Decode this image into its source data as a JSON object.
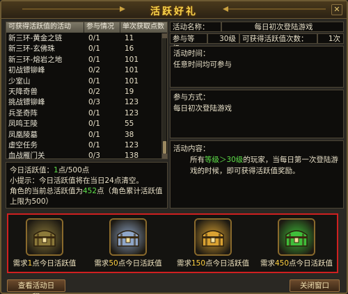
{
  "window": {
    "title": "活跃好礼",
    "close_glyph": "✕"
  },
  "activity_table": {
    "headers": [
      "可获得活跃值的活动",
      "参与情况",
      "单次获取点数"
    ],
    "rows": [
      {
        "name": "新三环-黄金之链",
        "progress": "0/1",
        "points": "11"
      },
      {
        "name": "新三环-玄佛珠",
        "progress": "0/1",
        "points": "16"
      },
      {
        "name": "新三环-熔岩之地",
        "progress": "0/1",
        "points": "101"
      },
      {
        "name": "初战镖铆峰",
        "progress": "0/2",
        "points": "101"
      },
      {
        "name": "少室山",
        "progress": "0/1",
        "points": "101"
      },
      {
        "name": "天降奇兽",
        "progress": "0/2",
        "points": "19"
      },
      {
        "name": "挑战镖铆峰",
        "progress": "0/3",
        "points": "123"
      },
      {
        "name": "兵圣奇阵",
        "progress": "0/1",
        "points": "123"
      },
      {
        "name": "凤鸣王陵",
        "progress": "0/1",
        "points": "55"
      },
      {
        "name": "凤凰陵墓",
        "progress": "0/1",
        "points": "38"
      },
      {
        "name": "虚空任务",
        "progress": "0/1",
        "points": "123"
      },
      {
        "name": "血战雁门关",
        "progress": "0/3",
        "points": "138"
      }
    ]
  },
  "today": {
    "label": "今日活跃值：",
    "current": "1",
    "suffix": "点/500点",
    "tip": "小提示：今日活跃值将在当日24点清空。",
    "total_prefix": "角色的当前总活跃值为",
    "total_value": "452",
    "total_suffix": "点（角色累计活跃值上限为500）"
  },
  "detail": {
    "name_label": "活动名称：",
    "name_value": "每日初次登陆游戏",
    "level_label": "参与等级：",
    "level_value": "30级",
    "count_label": "可获得活跃值次数：",
    "count_value": "1次",
    "time_label": "活动时间：",
    "time_value": "任意时间均可参与",
    "way_label": "参与方式：",
    "way_value": "每日初次登陆游戏",
    "content_label": "活动内容：",
    "content_pre": "所有",
    "content_level": "等级＞30级",
    "content_post": "的玩家，当每日第一次登陆游戏的时候，即可获得活跃值奖励。"
  },
  "rewards": [
    {
      "prefix": "需求",
      "value": "1",
      "suffix": "点今日活跃值",
      "icon": "bronze-chest-icon",
      "color": "#8c7a3a"
    },
    {
      "prefix": "需求",
      "value": "50",
      "suffix": "点今日活跃值",
      "icon": "silver-chest-icon",
      "color": "#8fa6c8"
    },
    {
      "prefix": "需求",
      "value": "150",
      "suffix": "点今日活跃值",
      "icon": "gold-chest-icon",
      "color": "#d9a232"
    },
    {
      "prefix": "需求",
      "value": "450",
      "suffix": "点今日活跃值",
      "icon": "jade-chest-icon",
      "color": "#3fbf3a"
    }
  ],
  "buttons": {
    "schedule": "查看活动日程",
    "close": "关闭窗口"
  }
}
